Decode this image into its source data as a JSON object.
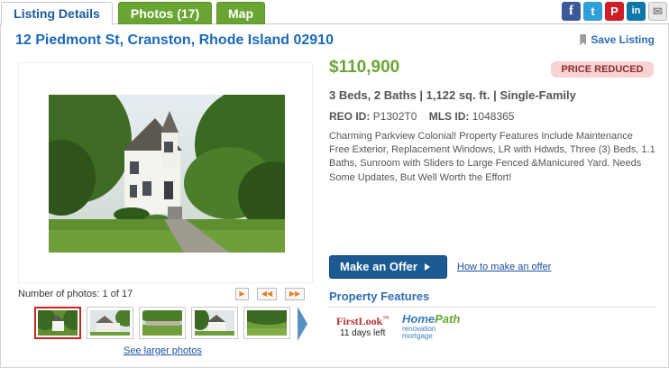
{
  "tabs": {
    "listing_details": "Listing Details",
    "photos": "Photos (17)",
    "map": "Map"
  },
  "social": {
    "facebook": "f",
    "twitter": "t",
    "pinterest": "P",
    "linkedin": "in",
    "email": "✉"
  },
  "listing": {
    "title": "12 Piedmont St, Cranston, Rhode Island 02910",
    "save_label": "Save Listing",
    "price": "$110,900",
    "badge": "PRICE REDUCED",
    "summary": "3 Beds, 2 Baths | 1,122 sq. ft. | Single-Family",
    "reo_label": "REO ID:",
    "reo_value": "P1302T0",
    "mls_label": "MLS ID:",
    "mls_value": "1048365",
    "description": "Charming Parkview Colonial! Property Features Include Maintenance Free Exterior, Replacement Windows, LR with Hdwds, Three (3) Beds, 1.1 Baths, Sunroom with Sliders to Large Fenced &Manicured Yard. Needs Some Updates, But Well Worth the Effort!"
  },
  "gallery": {
    "count_text": "Number of photos: 1 of 17",
    "play": "▶",
    "prev": "◀◀",
    "next": "▶▶",
    "larger_link": "See larger photos"
  },
  "offer": {
    "button": "Make an Offer",
    "howto": "How to make an offer"
  },
  "features": {
    "title": "Property Features",
    "firstlook_brand": "FirstLook",
    "firstlook_tm": "™",
    "firstlook_days": "11 days left",
    "homepath_home": "Home",
    "homepath_path": "Path",
    "homepath_line1": "renovation",
    "homepath_line2": "mortgage"
  },
  "colors": {
    "link_blue": "#1a6ab8",
    "brand_green": "#6aa534",
    "offer_navy": "#1b5a92",
    "badge_bg": "#f7d3d3"
  }
}
